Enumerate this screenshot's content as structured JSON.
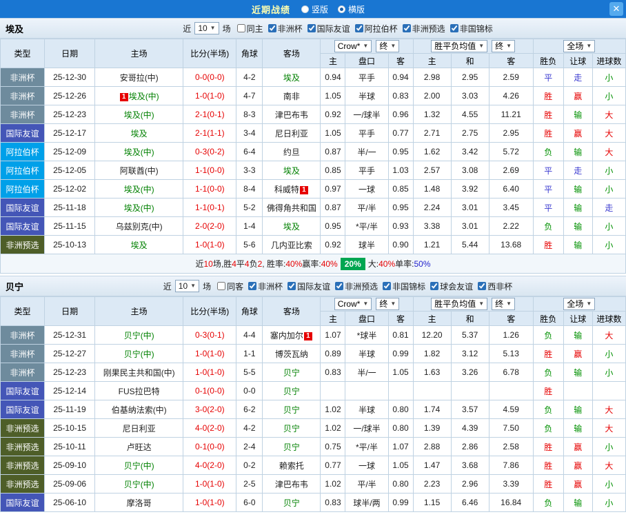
{
  "topbar": {
    "title": "近期战绩",
    "vertical_label": "竖版",
    "horizontal_label": "横版",
    "selected": "横版",
    "close_label": "✕",
    "bar_color": "#1976d2"
  },
  "type_colors": {
    "非洲杯": "#6e8b9d",
    "国际友谊": "#4456b7",
    "阿拉伯杯": "#00a0e9",
    "非洲预选": "#4e5e28"
  },
  "table_headers": {
    "fixed": [
      "类型",
      "日期",
      "主场",
      "比分(半场)",
      "角球",
      "客场"
    ],
    "odds_group": {
      "bookmaker": "Crow*",
      "final": "终"
    },
    "avg_group": {
      "label": "胜平负均值",
      "final": "终"
    },
    "scope_group": {
      "label": "全场"
    },
    "sub": [
      "主",
      "盘口",
      "客",
      "主",
      "和",
      "客",
      "胜负",
      "让球",
      "进球数"
    ]
  },
  "sections": [
    {
      "team": "埃及",
      "filter": {
        "near": "近",
        "count": "10",
        "games": "场",
        "same": {
          "label": "同主",
          "checked": false
        },
        "leagues": [
          {
            "label": "非洲杯",
            "checked": true
          },
          {
            "label": "国际友谊",
            "checked": true
          },
          {
            "label": "阿拉伯杯",
            "checked": true
          },
          {
            "label": "非洲预选",
            "checked": true
          },
          {
            "label": "非国锦标",
            "checked": true
          }
        ]
      },
      "rows": [
        {
          "type": "非洲杯",
          "date": "25-12-30",
          "home": {
            "name": "安哥拉(中)",
            "green": false
          },
          "score": "0-0(0-0)",
          "corner": "4-2",
          "away": {
            "name": "埃及",
            "green": true
          },
          "odds": [
            "0.94",
            "平手",
            "0.94"
          ],
          "avg": [
            "2.98",
            "2.95",
            "2.59"
          ],
          "result": "平",
          "handicap_res": "走",
          "goals_res": "小"
        },
        {
          "type": "非洲杯",
          "date": "25-12-26",
          "home": {
            "name": "埃及(中)",
            "green": true,
            "badge": {
              "text": "1",
              "pos": "before"
            }
          },
          "score": "1-0(1-0)",
          "corner": "4-7",
          "away": {
            "name": "南非",
            "green": false
          },
          "odds": [
            "1.05",
            "半球",
            "0.83"
          ],
          "avg": [
            "2.00",
            "3.03",
            "4.26"
          ],
          "result": "胜",
          "handicap_res": "赢",
          "goals_res": "小"
        },
        {
          "type": "非洲杯",
          "date": "25-12-23",
          "home": {
            "name": "埃及(中)",
            "green": true
          },
          "score": "2-1(0-1)",
          "corner": "8-3",
          "away": {
            "name": "津巴布韦",
            "green": false
          },
          "odds": [
            "0.92",
            "一/球半",
            "0.96"
          ],
          "avg": [
            "1.32",
            "4.55",
            "11.21"
          ],
          "result": "胜",
          "handicap_res": "输",
          "goals_res": "大"
        },
        {
          "type": "国际友谊",
          "date": "25-12-17",
          "home": {
            "name": "埃及",
            "green": true
          },
          "score": "2-1(1-1)",
          "corner": "3-4",
          "away": {
            "name": "尼日利亚",
            "green": false
          },
          "odds": [
            "1.05",
            "平手",
            "0.77"
          ],
          "avg": [
            "2.71",
            "2.75",
            "2.95"
          ],
          "result": "胜",
          "handicap_res": "赢",
          "goals_res": "大"
        },
        {
          "type": "阿拉伯杯",
          "date": "25-12-09",
          "home": {
            "name": "埃及(中)",
            "green": true
          },
          "score": "0-3(0-2)",
          "corner": "6-4",
          "away": {
            "name": "约旦",
            "green": false
          },
          "odds": [
            "0.87",
            "半/一",
            "0.95"
          ],
          "avg": [
            "1.62",
            "3.42",
            "5.72"
          ],
          "result": "负",
          "handicap_res": "输",
          "goals_res": "大"
        },
        {
          "type": "阿拉伯杯",
          "date": "25-12-05",
          "home": {
            "name": "阿联酋(中)",
            "green": false
          },
          "score": "1-1(0-0)",
          "corner": "3-3",
          "away": {
            "name": "埃及",
            "green": true
          },
          "odds": [
            "0.85",
            "平手",
            "1.03"
          ],
          "avg": [
            "2.57",
            "3.08",
            "2.69"
          ],
          "result": "平",
          "handicap_res": "走",
          "goals_res": "小"
        },
        {
          "type": "阿拉伯杯",
          "date": "25-12-02",
          "home": {
            "name": "埃及(中)",
            "green": true
          },
          "score": "1-1(0-0)",
          "corner": "8-4",
          "away": {
            "name": "科威特",
            "green": false,
            "badge": {
              "text": "1",
              "pos": "after"
            }
          },
          "odds": [
            "0.97",
            "一球",
            "0.85"
          ],
          "avg": [
            "1.48",
            "3.92",
            "6.40"
          ],
          "result": "平",
          "handicap_res": "输",
          "goals_res": "小"
        },
        {
          "type": "国际友谊",
          "date": "25-11-18",
          "home": {
            "name": "埃及(中)",
            "green": true
          },
          "score": "1-1(0-1)",
          "corner": "5-2",
          "away": {
            "name": "佛得角共和国",
            "green": false
          },
          "odds": [
            "0.87",
            "平/半",
            "0.95"
          ],
          "avg": [
            "2.24",
            "3.01",
            "3.45"
          ],
          "result": "平",
          "handicap_res": "输",
          "goals_res": "走"
        },
        {
          "type": "国际友谊",
          "date": "25-11-15",
          "home": {
            "name": "乌兹别克(中)",
            "green": false
          },
          "score": "2-0(2-0)",
          "corner": "1-4",
          "away": {
            "name": "埃及",
            "green": true
          },
          "odds": [
            "0.95",
            "*平/半",
            "0.93"
          ],
          "avg": [
            "3.38",
            "3.01",
            "2.22"
          ],
          "result": "负",
          "handicap_res": "输",
          "goals_res": "小"
        },
        {
          "type": "非洲预选",
          "date": "25-10-13",
          "home": {
            "name": "埃及",
            "green": true
          },
          "score": "1-0(1-0)",
          "corner": "5-6",
          "away": {
            "name": "几内亚比索",
            "green": false
          },
          "odds": [
            "0.92",
            "球半",
            "0.90"
          ],
          "avg": [
            "1.21",
            "5.44",
            "13.68"
          ],
          "result": "胜",
          "handicap_res": "输",
          "goals_res": "小"
        }
      ],
      "summary": [
        {
          "t": "近",
          "c": "k"
        },
        {
          "t": "10",
          "c": "r"
        },
        {
          "t": "场,胜",
          "c": "k"
        },
        {
          "t": "4",
          "c": "r"
        },
        {
          "t": "平",
          "c": "k"
        },
        {
          "t": "4",
          "c": "r"
        },
        {
          "t": "负",
          "c": "k"
        },
        {
          "t": "2",
          "c": "r"
        },
        {
          "t": ", 胜率:",
          "c": "k"
        },
        {
          "t": "40%",
          "c": "r"
        },
        {
          "t": " 赢率:",
          "c": "k"
        },
        {
          "t": "40%",
          "c": "r"
        },
        {
          "t": "20%",
          "c": "gb"
        },
        {
          "t": "大:",
          "c": "k"
        },
        {
          "t": "40%",
          "c": "r"
        },
        {
          "t": " 单率:",
          "c": "k"
        },
        {
          "t": "50%",
          "c": "b"
        }
      ]
    },
    {
      "team": "贝宁",
      "filter": {
        "near": "近",
        "count": "10",
        "games": "场",
        "same": {
          "label": "同客",
          "checked": false
        },
        "leagues": [
          {
            "label": "非洲杯",
            "checked": true
          },
          {
            "label": "国际友谊",
            "checked": true
          },
          {
            "label": "非洲预选",
            "checked": true
          },
          {
            "label": "非国锦标",
            "checked": true
          },
          {
            "label": "球会友谊",
            "checked": true
          },
          {
            "label": "西非杯",
            "checked": true
          }
        ]
      },
      "rows": [
        {
          "type": "非洲杯",
          "date": "25-12-31",
          "home": {
            "name": "贝宁(中)",
            "green": true
          },
          "score": "0-3(0-1)",
          "corner": "4-4",
          "away": {
            "name": "塞内加尔",
            "green": false,
            "badge": {
              "text": "1",
              "pos": "after"
            }
          },
          "odds": [
            "1.07",
            "*球半",
            "0.81"
          ],
          "avg": [
            "12.20",
            "5.37",
            "1.26"
          ],
          "result": "负",
          "handicap_res": "输",
          "goals_res": "大"
        },
        {
          "type": "非洲杯",
          "date": "25-12-27",
          "home": {
            "name": "贝宁(中)",
            "green": true
          },
          "score": "1-0(1-0)",
          "corner": "1-1",
          "away": {
            "name": "博茨瓦纳",
            "green": false
          },
          "odds": [
            "0.89",
            "半球",
            "0.99"
          ],
          "avg": [
            "1.82",
            "3.12",
            "5.13"
          ],
          "result": "胜",
          "handicap_res": "赢",
          "goals_res": "小"
        },
        {
          "type": "非洲杯",
          "date": "25-12-23",
          "home": {
            "name": "刚果民主共和国(中)",
            "green": false
          },
          "score": "1-0(1-0)",
          "corner": "5-5",
          "away": {
            "name": "贝宁",
            "green": true
          },
          "odds": [
            "0.83",
            "半/一",
            "1.05"
          ],
          "avg": [
            "1.63",
            "3.26",
            "6.78"
          ],
          "result": "负",
          "handicap_res": "输",
          "goals_res": "小"
        },
        {
          "type": "国际友谊",
          "date": "25-12-14",
          "home": {
            "name": "FUS拉巴特",
            "green": false
          },
          "score": "0-1(0-0)",
          "corner": "0-0",
          "away": {
            "name": "贝宁",
            "green": true
          },
          "odds": [
            "",
            "",
            ""
          ],
          "avg": [
            "",
            "",
            ""
          ],
          "result": "胜",
          "handicap_res": "",
          "goals_res": ""
        },
        {
          "type": "国际友谊",
          "date": "25-11-19",
          "home": {
            "name": "伯基纳法索(中)",
            "green": false
          },
          "score": "3-0(2-0)",
          "corner": "6-2",
          "away": {
            "name": "贝宁",
            "green": true
          },
          "odds": [
            "1.02",
            "半球",
            "0.80"
          ],
          "avg": [
            "1.74",
            "3.57",
            "4.59"
          ],
          "result": "负",
          "handicap_res": "输",
          "goals_res": "大"
        },
        {
          "type": "非洲预选",
          "date": "25-10-15",
          "home": {
            "name": "尼日利亚",
            "green": false
          },
          "score": "4-0(2-0)",
          "corner": "4-2",
          "away": {
            "name": "贝宁",
            "green": true
          },
          "odds": [
            "1.02",
            "一/球半",
            "0.80"
          ],
          "avg": [
            "1.39",
            "4.39",
            "7.50"
          ],
          "result": "负",
          "handicap_res": "输",
          "goals_res": "大"
        },
        {
          "type": "非洲预选",
          "date": "25-10-11",
          "home": {
            "name": "卢旺达",
            "green": false
          },
          "score": "0-1(0-0)",
          "corner": "2-4",
          "away": {
            "name": "贝宁",
            "green": true
          },
          "odds": [
            "0.75",
            "*平/半",
            "1.07"
          ],
          "avg": [
            "2.88",
            "2.86",
            "2.58"
          ],
          "result": "胜",
          "handicap_res": "赢",
          "goals_res": "小"
        },
        {
          "type": "非洲预选",
          "date": "25-09-10",
          "home": {
            "name": "贝宁(中)",
            "green": true
          },
          "score": "4-0(2-0)",
          "corner": "0-2",
          "away": {
            "name": "赖索托",
            "green": false
          },
          "odds": [
            "0.77",
            "一球",
            "1.05"
          ],
          "avg": [
            "1.47",
            "3.68",
            "7.86"
          ],
          "result": "胜",
          "handicap_res": "赢",
          "goals_res": "大"
        },
        {
          "type": "非洲预选",
          "date": "25-09-06",
          "home": {
            "name": "贝宁(中)",
            "green": true
          },
          "score": "1-0(1-0)",
          "corner": "2-5",
          "away": {
            "name": "津巴布韦",
            "green": false
          },
          "odds": [
            "1.02",
            "平/半",
            "0.80"
          ],
          "avg": [
            "2.23",
            "2.96",
            "3.39"
          ],
          "result": "胜",
          "handicap_res": "赢",
          "goals_res": "小"
        },
        {
          "type": "国际友谊",
          "date": "25-06-10",
          "home": {
            "name": "摩洛哥",
            "green": false
          },
          "score": "1-0(1-0)",
          "corner": "6-0",
          "away": {
            "name": "贝宁",
            "green": true
          },
          "odds": [
            "0.83",
            "球半/两",
            "0.99"
          ],
          "avg": [
            "1.15",
            "6.46",
            "16.84"
          ],
          "result": "负",
          "handicap_res": "输",
          "goals_res": "小"
        }
      ]
    }
  ]
}
